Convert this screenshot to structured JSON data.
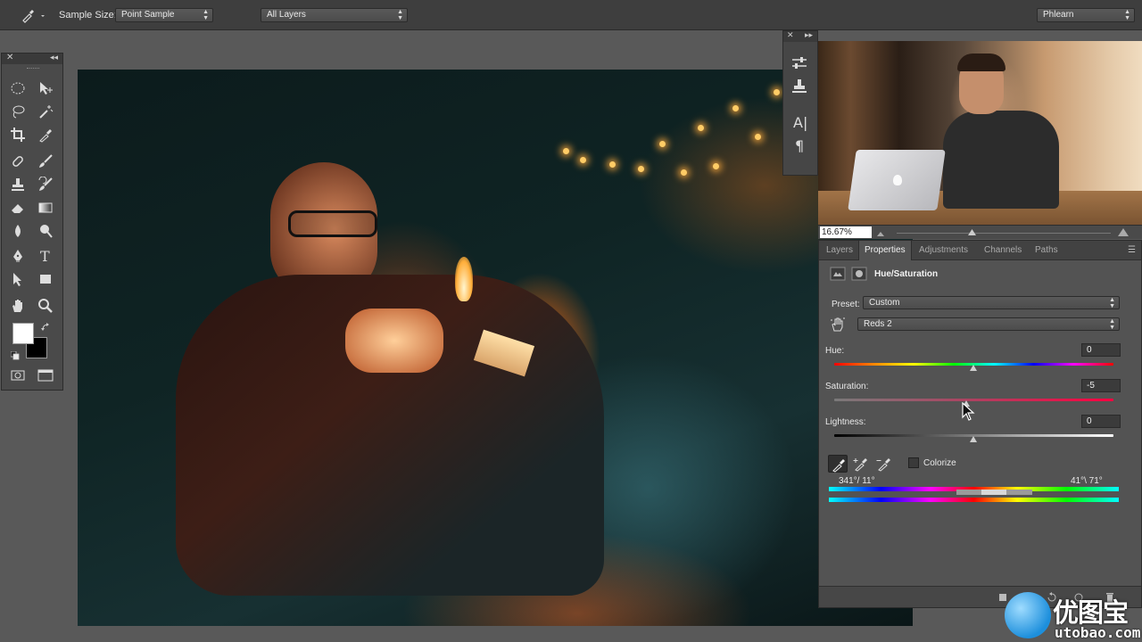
{
  "options_bar": {
    "tool": "eyedropper-icon",
    "sample_size_label": "Sample Size:",
    "sample_size_value": "Point Sample",
    "sample_layers_value": "All Layers",
    "workspace_value": "Phlearn"
  },
  "tools_panel": {
    "tools": [
      "elliptical-marquee-icon",
      "move-icon",
      "lasso-icon",
      "magic-wand-icon",
      "crop-icon",
      "eyedropper-icon",
      "healing-brush-icon",
      "brush-icon",
      "clone-stamp-icon",
      "history-brush-icon",
      "eraser-icon",
      "gradient-icon",
      "blur-icon",
      "dodge-icon",
      "pen-icon",
      "type-icon",
      "path-selection-icon",
      "rectangle-icon",
      "hand-icon",
      "zoom-icon",
      "quick-mask-icon",
      "screen-mode-icon"
    ],
    "type_glyph": "T",
    "foreground_color": "#ffffff",
    "background_color": "#000000"
  },
  "side_strip": {
    "close": "✕",
    "collapse": "▸▸",
    "paragraph_glyph": "¶",
    "char_glyph": "A|"
  },
  "navigator": {
    "zoom": "16.67%"
  },
  "panel": {
    "tabs": [
      "Layers",
      "Properties",
      "Adjustments",
      "Channels",
      "Paths"
    ],
    "active_tab": "Properties",
    "title": "Hue/Saturation",
    "preset_label": "Preset:",
    "preset_value": "Custom",
    "range_value": "Reds 2",
    "hue_label": "Hue:",
    "hue_value": "0",
    "saturation_label": "Saturation:",
    "saturation_value": "-5",
    "lightness_label": "Lightness:",
    "lightness_value": "0",
    "colorize_label": "Colorize",
    "colorize_checked": false,
    "range_left": "341°/ 11°",
    "range_right": "41°\\ 71°"
  },
  "watermark": {
    "cn": "优图宝",
    "en": "utobao.com"
  }
}
